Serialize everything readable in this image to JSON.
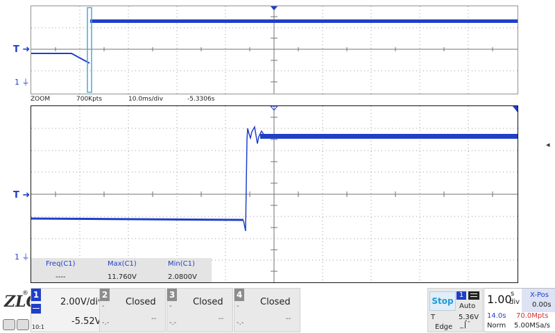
{
  "zoom": {
    "label": "ZOOM",
    "points": "700Kpts",
    "timebase": "10.0ms/div",
    "position": "-5.3306s"
  },
  "markers": {
    "trigger": "T",
    "channel1": "1"
  },
  "measurements": {
    "headers": [
      "Freq(C1)",
      "Max(C1)",
      "Min(C1)"
    ],
    "values": [
      "----",
      "11.760V",
      "2.0800V"
    ]
  },
  "channels": [
    {
      "num": "1",
      "scale": "2.00V/div",
      "offset": "-5.52V",
      "coupling": "10:1",
      "active": true
    },
    {
      "num": "2",
      "status": "Closed",
      "small1": "-",
      "small2": "-.-",
      "small3": "--"
    },
    {
      "num": "3",
      "status": "Closed",
      "small1": "-",
      "small2": "-.-",
      "small3": "--"
    },
    {
      "num": "4",
      "status": "Closed",
      "small1": "-",
      "small2": "-.-",
      "small3": "--"
    }
  ],
  "trigger": {
    "state": "Stop",
    "source": "1",
    "mode": "Auto",
    "label": "T",
    "level": "5.36V",
    "type": "Edge"
  },
  "timebase": {
    "value": "1.00",
    "unit_top": "s",
    "unit_bottom": "div",
    "xpos_label": "X-Pos",
    "xpos_value": "0.00s",
    "span": "14.0s",
    "memory": "70.0Mpts",
    "acq_mode": "Norm",
    "sample_rate": "5.00MSa/s"
  },
  "colors": {
    "trace": "#1f3fc8",
    "grid": "#9a9a9a",
    "stop": "#1e9ad6",
    "memory": "#d03030"
  }
}
